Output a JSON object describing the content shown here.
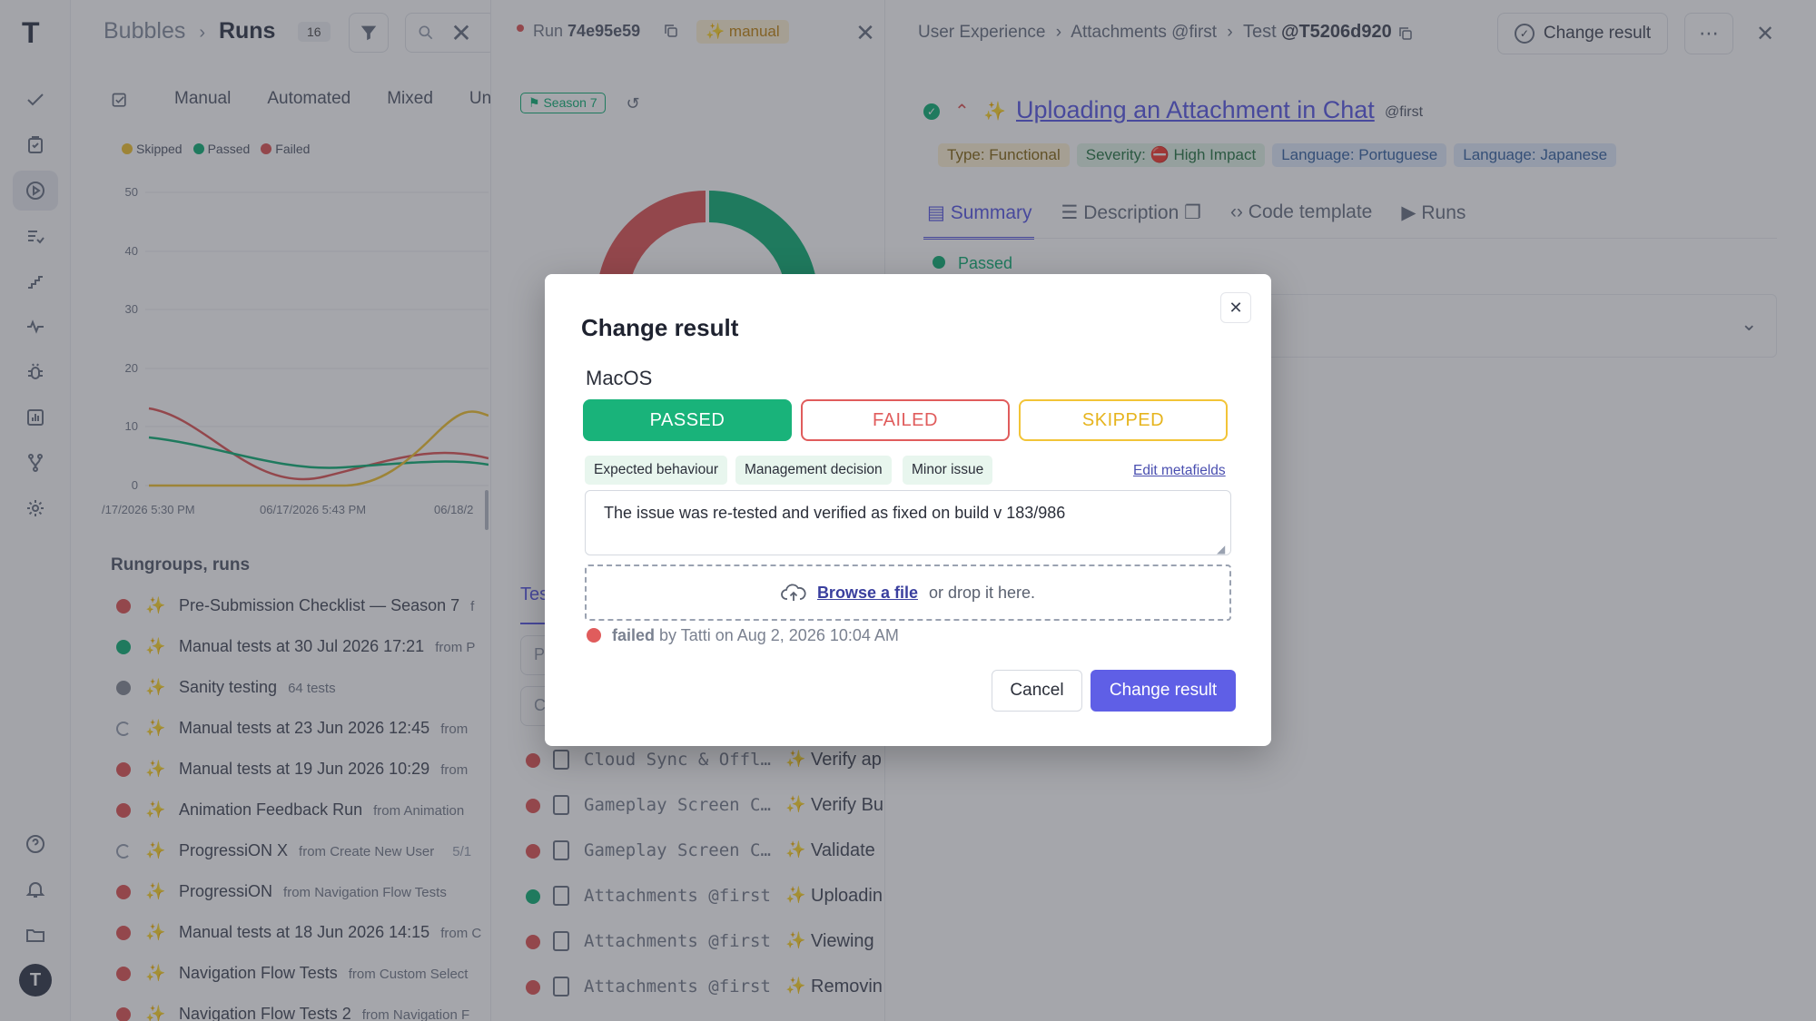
{
  "colors": {
    "accent": "#5f5fe6",
    "passed": "#19b37a",
    "failed": "#e05c5c",
    "skipped": "#f2c437",
    "overlay": "rgba(40,44,54,0.42)"
  },
  "sidebar": {
    "logo": "T",
    "items": [
      {
        "icon": "check-icon"
      },
      {
        "icon": "clipboard-icon"
      },
      {
        "icon": "play-circle-icon"
      },
      {
        "icon": "list-check-icon"
      },
      {
        "icon": "steps-icon"
      },
      {
        "icon": "pulse-icon"
      },
      {
        "icon": "bug-icon"
      },
      {
        "icon": "bar-chart-icon"
      },
      {
        "icon": "branch-icon"
      },
      {
        "icon": "gear-icon"
      }
    ],
    "bottom": [
      {
        "icon": "help-icon"
      },
      {
        "icon": "bell-icon"
      },
      {
        "icon": "folders-icon"
      }
    ],
    "avatar": "T"
  },
  "runs_panel": {
    "breadcrumb_project": "Bubbles",
    "breadcrumb_page": "Runs",
    "count": "16",
    "tabs": [
      "Manual",
      "Automated",
      "Mixed",
      "Unf"
    ],
    "legend": [
      "Skipped",
      "Passed",
      "Failed"
    ],
    "chart_yticks": [
      "50",
      "40",
      "30",
      "20",
      "10",
      "0"
    ],
    "chart_xticks": [
      "/17/2026 5:30 PM",
      "06/17/2026 5:43 PM",
      "06/18/2"
    ],
    "section_title": "Rungroups, runs",
    "runs": [
      {
        "status": "failed",
        "title": "Pre-Submission Checklist — Season 7",
        "suffix": "f"
      },
      {
        "status": "passed",
        "title": "Manual tests at 30 Jul 2026 17:21",
        "suffix": "from P"
      },
      {
        "status": "grey",
        "title": "Sanity testing",
        "suffix": "64 tests"
      },
      {
        "status": "running",
        "title": "Manual tests at 23 Jun 2026 12:45",
        "suffix": "from"
      },
      {
        "status": "failed",
        "title": "Manual tests at 19 Jun 2026 10:29",
        "suffix": "from"
      },
      {
        "status": "failed",
        "title": "Animation Feedback Run",
        "suffix": "from Animation"
      },
      {
        "status": "running",
        "title": "ProgressiON X",
        "suffix": "from Create New User",
        "extra": "5/1"
      },
      {
        "status": "failed",
        "title": "ProgressiON",
        "suffix": "from Navigation Flow Tests"
      },
      {
        "status": "failed",
        "title": "Manual tests at 18 Jun 2026 14:15",
        "suffix": "from C"
      },
      {
        "status": "failed",
        "title": "Navigation Flow Tests",
        "suffix": "from Custom Select"
      },
      {
        "status": "failed",
        "title": "Navigation Flow Tests 2",
        "suffix": "from Navigation F"
      }
    ]
  },
  "run_panel": {
    "run_label": "Run",
    "run_id": "74e95e59",
    "mode_badge": "manual",
    "season_badge": "Season 7",
    "tab_partial": "Tes",
    "search_placeholder": "P",
    "filter_placeholder": "C",
    "tests": [
      {
        "status": "failed",
        "suite": "Cloud Sync & Offl…",
        "title": "Verify ap"
      },
      {
        "status": "failed",
        "suite": "Gameplay Screen C…",
        "title": "Verify Bu"
      },
      {
        "status": "failed",
        "suite": "Gameplay Screen C…",
        "title": "Validate"
      },
      {
        "status": "passed",
        "suite": "Attachments @first",
        "title": "Uploadin"
      },
      {
        "status": "failed",
        "suite": "Attachments @first",
        "title": "Viewing"
      },
      {
        "status": "failed",
        "suite": "Attachments @first",
        "title": "Removin"
      }
    ]
  },
  "test_panel": {
    "breadcrumb": [
      "User Experience",
      "Attachments @first",
      "Test"
    ],
    "test_id": "@T5206d920",
    "change_result_label": "Change result",
    "title": "Uploading an Attachment in Chat",
    "title_tag": "@first",
    "labels": [
      {
        "text": "Type: Functional",
        "kind": "yellow"
      },
      {
        "text": "Severity: ⛔ High Impact",
        "kind": "green"
      },
      {
        "text": "Language: Portuguese",
        "kind": "blue"
      },
      {
        "text": "Language: Japanese",
        "kind": "blue"
      }
    ],
    "tabs": [
      "Summary",
      "Description",
      "Code template",
      "Runs"
    ],
    "status": "Passed"
  },
  "modal": {
    "title": "Change result",
    "env": "MacOS",
    "passed": "PASSED",
    "failed": "FAILED",
    "skipped": "SKIPPED",
    "tags": [
      "Expected behaviour",
      "Management decision",
      "Minor issue"
    ],
    "edit_metafields": "Edit metafields",
    "message": "The issue was re-tested and verified as fixed on build v 183/986",
    "browse": "Browse a file",
    "drop": "or drop it here.",
    "history_status": "failed",
    "history_rest": "by Tatti on Aug 2, 2026 10:04 AM",
    "cancel": "Cancel",
    "submit": "Change result"
  }
}
